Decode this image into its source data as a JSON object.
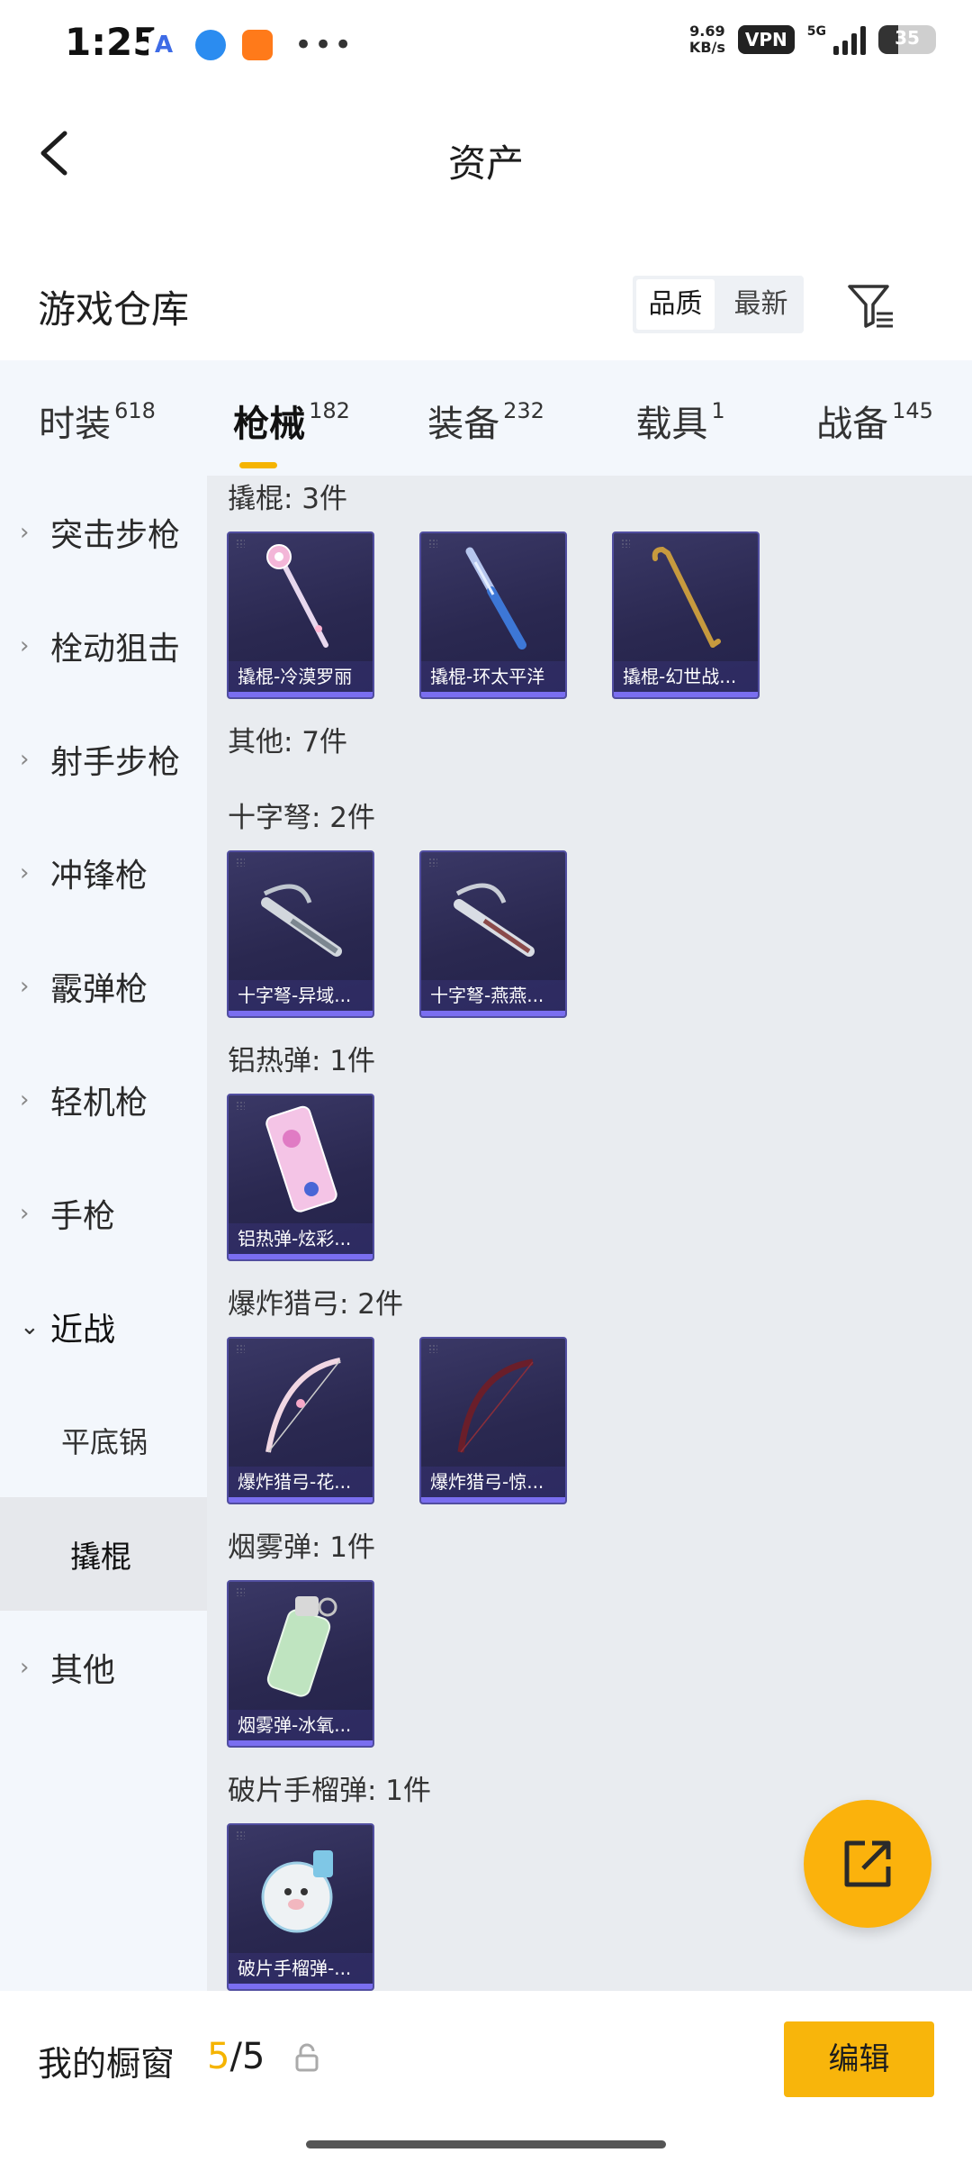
{
  "status_bar": {
    "time": "1:25",
    "speed_value": "9.69",
    "speed_unit": "KB/s",
    "vpn": "VPN",
    "network": "5G",
    "battery": "35"
  },
  "header": {
    "title": "资产"
  },
  "warehouse": {
    "title": "游戏仓库",
    "sort_options": [
      "品质",
      "最新"
    ],
    "active_sort": "品质"
  },
  "tabs": [
    {
      "label": "时装",
      "count": "618"
    },
    {
      "label": "枪械",
      "count": "182",
      "active": true
    },
    {
      "label": "装备",
      "count": "232"
    },
    {
      "label": "载具",
      "count": "1"
    },
    {
      "label": "战备",
      "count": "145"
    }
  ],
  "sidebar": {
    "categories": [
      {
        "label": "突击步枪"
      },
      {
        "label": "栓动狙击"
      },
      {
        "label": "射手步枪"
      },
      {
        "label": "冲锋枪"
      },
      {
        "label": "霰弹枪"
      },
      {
        "label": "轻机枪"
      },
      {
        "label": "手枪"
      },
      {
        "label": "近战",
        "open": true
      },
      {
        "label": "平底锅",
        "sub": true
      },
      {
        "label": "撬棍",
        "sub": true,
        "selected": true
      },
      {
        "label": "其他"
      }
    ]
  },
  "groups": [
    {
      "title": "撬棍: 3件",
      "items": [
        "撬棍-冷漠罗丽",
        "撬棍-环太平洋",
        "撬棍-幻世战..."
      ]
    },
    {
      "title": "其他: 7件",
      "items": []
    },
    {
      "title": "十字弩: 2件",
      "items": [
        "十字弩-异域...",
        "十字弩-燕燕..."
      ]
    },
    {
      "title": "铝热弹: 1件",
      "items": [
        "铝热弹-炫彩..."
      ]
    },
    {
      "title": "爆炸猎弓: 2件",
      "items": [
        "爆炸猎弓-花...",
        "爆炸猎弓-惊..."
      ]
    },
    {
      "title": "烟雾弹: 1件",
      "items": [
        "烟雾弹-冰氧..."
      ]
    },
    {
      "title": "破片手榴弹: 1件",
      "items": [
        "破片手榴弹-..."
      ]
    }
  ],
  "bottom": {
    "title": "我的橱窗",
    "current": "5",
    "separator": "/",
    "total": "5",
    "edit_label": "编辑"
  },
  "colors": {
    "accent": "#f5b400",
    "card_bg": "#2a2850",
    "card_border": "#514ea0"
  }
}
